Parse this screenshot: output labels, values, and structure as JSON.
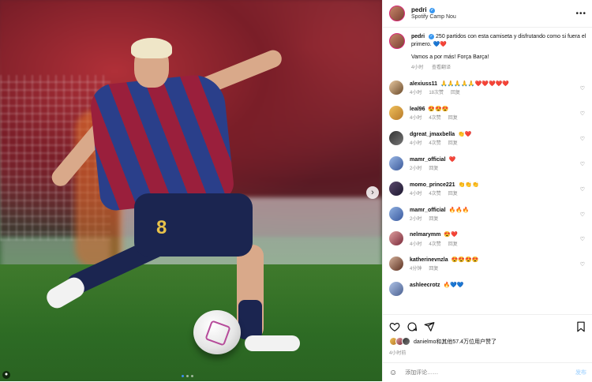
{
  "post": {
    "username": "pedri",
    "location": "Spotify Camp Nou",
    "more_icon": "more-horizontal-icon"
  },
  "caption": {
    "username": "pedri",
    "line1": "250 partidos con esta camiseta y disfrutando como si fuera el primero. 💙❤️",
    "line2": "Vamos a por más! Força Barça!",
    "time": "4小时",
    "translation": "查看翻译"
  },
  "comments": [
    {
      "username": "alexiuss11",
      "text": "🙏🙏🙏🙏🙏❤️❤️❤️❤️❤️",
      "time": "4小时",
      "likes": "18次赞",
      "reply": "回复"
    },
    {
      "username": "leal96",
      "text": "😍😍😍",
      "time": "4小时",
      "likes": "4次赞",
      "reply": "回复"
    },
    {
      "username": "dgreat_jmaxbella",
      "text": "👏❤️",
      "time": "4小时",
      "likes": "4次赞",
      "reply": "回复"
    },
    {
      "username": "mamr_official",
      "text": "❤️",
      "time": "2小时",
      "likes": "",
      "reply": "回复"
    },
    {
      "username": "momo_prince221",
      "text": "👏👏👏",
      "time": "4小时",
      "likes": "4次赞",
      "reply": "回复"
    },
    {
      "username": "mamr_official",
      "text": "🔥🔥🔥",
      "time": "2小时",
      "likes": "",
      "reply": "回复"
    },
    {
      "username": "nelmarymm",
      "text": "😍❤️",
      "time": "4小时",
      "likes": "4次赞",
      "reply": "回复"
    },
    {
      "username": "katherinevnzla",
      "text": "😍😍😍😍",
      "time": "4分钟",
      "likes": "",
      "reply": "回复"
    },
    {
      "username": "ashleecrotz",
      "text": "🔥💙💙",
      "time": "",
      "likes": "",
      "reply": ""
    }
  ],
  "actions": {
    "like_icon": "heart-icon",
    "comment_icon": "comment-icon",
    "share_icon": "share-icon",
    "save_icon": "bookmark-icon"
  },
  "likes_text": "danielmo和其他57.4万位用户赞了",
  "post_time": "4小时前",
  "add_comment": {
    "placeholder": "添加评论……",
    "post_label": "发布"
  },
  "carousel": {
    "next_icon": "chevron-right-icon",
    "slides": 3,
    "current": 1
  },
  "photo": {
    "jersey_number": "8"
  }
}
